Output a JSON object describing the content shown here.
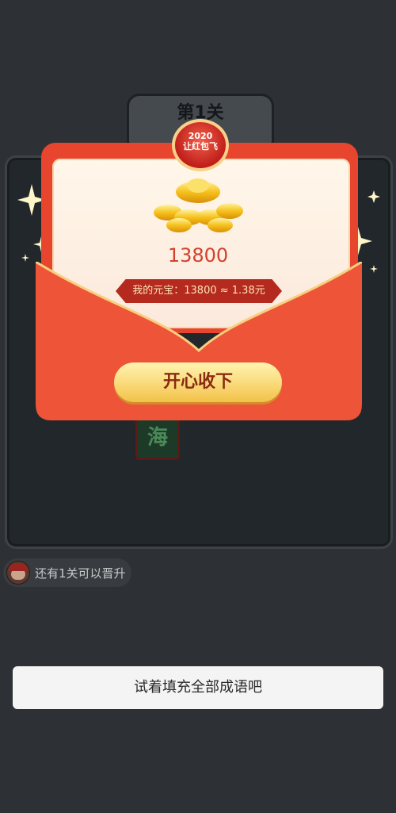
{
  "background": {
    "level_title": "第1关",
    "tile_char": "海",
    "progress_text": "还有1关可以晋升",
    "hint": "试着填充全部成语吧"
  },
  "popup": {
    "badge_year": "2020",
    "badge_sub": "让红包飞",
    "amount": "13800",
    "balance": "我的元宝：13800 ≈ 1.38元",
    "accept_button": "开心收下"
  },
  "colors": {
    "envelope_red": "#e8452f",
    "button_gold": "#f9d774",
    "page_bg": "#2d3135"
  },
  "icons": [
    "sparkle-icon",
    "gold-ingot-icon",
    "avatar"
  ]
}
